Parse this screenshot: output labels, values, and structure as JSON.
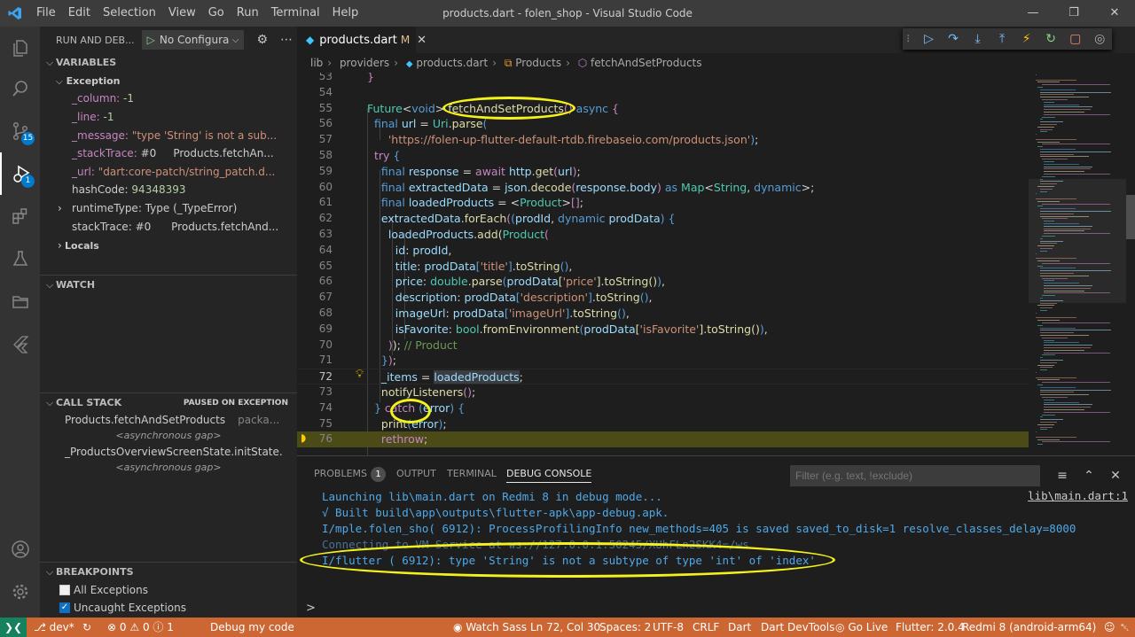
{
  "window": {
    "title": "products.dart - folen_shop - Visual Studio Code",
    "logo": "vscode-logo",
    "menu": [
      "File",
      "Edit",
      "Selection",
      "View",
      "Go",
      "Run",
      "Terminal",
      "Help"
    ]
  },
  "activity_bar": {
    "items": [
      {
        "name": "explorer-icon"
      },
      {
        "name": "search-icon"
      },
      {
        "name": "source-control-icon",
        "badge": "15"
      },
      {
        "name": "run-debug-icon",
        "badge": "1",
        "active": true
      },
      {
        "name": "extensions-icon"
      },
      {
        "name": "testing-icon"
      },
      {
        "name": "folder-icon"
      },
      {
        "name": "flutter-icon"
      }
    ],
    "bottom": [
      {
        "name": "account-icon"
      },
      {
        "name": "manage-gear-icon"
      }
    ]
  },
  "sidebar": {
    "header": "RUN AND DEB...",
    "config": "No Configurat",
    "variables": {
      "title": "VARIABLES",
      "scope": "Exception",
      "rows": [
        {
          "name": "_column:",
          "value": "-1"
        },
        {
          "name": "_line:",
          "value": "-1"
        },
        {
          "name": "_message:",
          "value": "\"type 'String' is not a sub..."
        },
        {
          "name": "_stackTrace:",
          "value": "#0",
          "extra": "Products.fetchAn..."
        },
        {
          "name": "_url:",
          "value": "\"dart:core-patch/string_patch.d..."
        },
        {
          "name": "hashCode:",
          "value": "94348393"
        },
        {
          "name": "runtimeType:",
          "value": "Type (_TypeError)"
        },
        {
          "name": "stackTrace:",
          "value": "#0",
          "extra": "Products.fetchAnd..."
        }
      ],
      "locals": "Locals"
    },
    "watch": {
      "title": "WATCH"
    },
    "call_stack": {
      "title": "CALL STACK",
      "status": "PAUSED ON EXCEPTION",
      "frames": [
        {
          "name": "Products.fetchAndSetProducts",
          "file": "packa..."
        },
        {
          "gap": "<asynchronous gap>"
        },
        {
          "name": "_ProductsOverviewScreenState.initState."
        },
        {
          "gap": "<asynchronous gap>"
        }
      ]
    },
    "breakpoints": {
      "title": "BREAKPOINTS",
      "items": [
        {
          "label": "All Exceptions",
          "checked": false
        },
        {
          "label": "Uncaught Exceptions",
          "checked": true
        }
      ]
    }
  },
  "editor": {
    "tab": {
      "label": "products.dart",
      "modified": "M"
    },
    "breadcrumb": [
      "lib",
      "providers",
      "products.dart",
      "Products",
      "fetchAndSetProducts"
    ],
    "lines": [
      {
        "n": "53",
        "code": "  }"
      },
      {
        "n": "54",
        "code": ""
      },
      {
        "n": "55",
        "code": "  Future<void> fetchAndSetProducts() async {"
      },
      {
        "n": "56",
        "code": "    final url = Uri.parse("
      },
      {
        "n": "57",
        "code": "        'https://folen-up-flutter-default-rtdb.firebaseio.com/products.json');"
      },
      {
        "n": "58",
        "code": "    try {"
      },
      {
        "n": "59",
        "code": "      final response = await http.get(url);"
      },
      {
        "n": "60",
        "code": "      final extractedData = json.decode(response.body) as Map<String, dynamic>;"
      },
      {
        "n": "61",
        "code": "      final loadedProducts = <Product>[];"
      },
      {
        "n": "62",
        "code": "      extractedData.forEach((prodId, dynamic prodData) {"
      },
      {
        "n": "63",
        "code": "        loadedProducts.add(Product("
      },
      {
        "n": "64",
        "code": "          id: prodId,"
      },
      {
        "n": "65",
        "code": "          title: prodData['title'].toString(),"
      },
      {
        "n": "66",
        "code": "          price: double.parse(prodData['price'].toString()),"
      },
      {
        "n": "67",
        "code": "          description: prodData['description'].toString(),"
      },
      {
        "n": "68",
        "code": "          imageUrl: prodData['imageUrl'].toString(),"
      },
      {
        "n": "69",
        "code": "          isFavorite: bool.fromEnvironment(prodData['isFavorite'].toString()),"
      },
      {
        "n": "70",
        "code": "        )); // Product"
      },
      {
        "n": "71",
        "code": "      });"
      },
      {
        "n": "72",
        "code": "      _items = loadedProducts;"
      },
      {
        "n": "73",
        "code": "      notifyListeners();"
      },
      {
        "n": "74",
        "code": "    } catch (error) {"
      },
      {
        "n": "75",
        "code": "      print(error);"
      },
      {
        "n": "76",
        "code": "      rethrow;"
      }
    ]
  },
  "panel": {
    "tabs": [
      {
        "label": "PROBLEMS",
        "badge": "1"
      },
      {
        "label": "OUTPUT"
      },
      {
        "label": "TERMINAL"
      },
      {
        "label": "DEBUG CONSOLE",
        "active": true
      }
    ],
    "filter_placeholder": "Filter (e.g. text, !exclude)",
    "source_ref": "lib\\main.dart:1",
    "console": [
      "Launching lib\\main.dart on Redmi 8 in debug mode...",
      "√ Built build\\app\\outputs\\flutter-apk\\app-debug.apk.",
      "I/mple.folen_sho( 6912): ProcessProfilingInfo new_methods=405 is saved saved_to_disk=1 resolve_classes_delay=8000",
      "Connecting to VM Service at ws://127.0.0.1:50245/XUhFLn2SKK4=/ws",
      "I/flutter ( 6912): type 'String' is not a subtype of type 'int' of 'index'"
    ],
    "prompt": ">"
  },
  "status_bar": {
    "branch": "dev*",
    "errors": "0",
    "warnings": "0",
    "info": "1",
    "debug": "Debug my code",
    "right": [
      "Watch Sass",
      "Ln 72, Col 30",
      "Spaces: 2",
      "UTF-8",
      "CRLF",
      "Dart",
      "Dart DevTools",
      "Go Live",
      "Flutter: 2.0.4",
      "Redmi 8 (android-arm64)"
    ]
  },
  "colors": {
    "statusbar": "#cc6633",
    "annotation": "#f4f21a",
    "exception_line": "#4b4b18"
  }
}
